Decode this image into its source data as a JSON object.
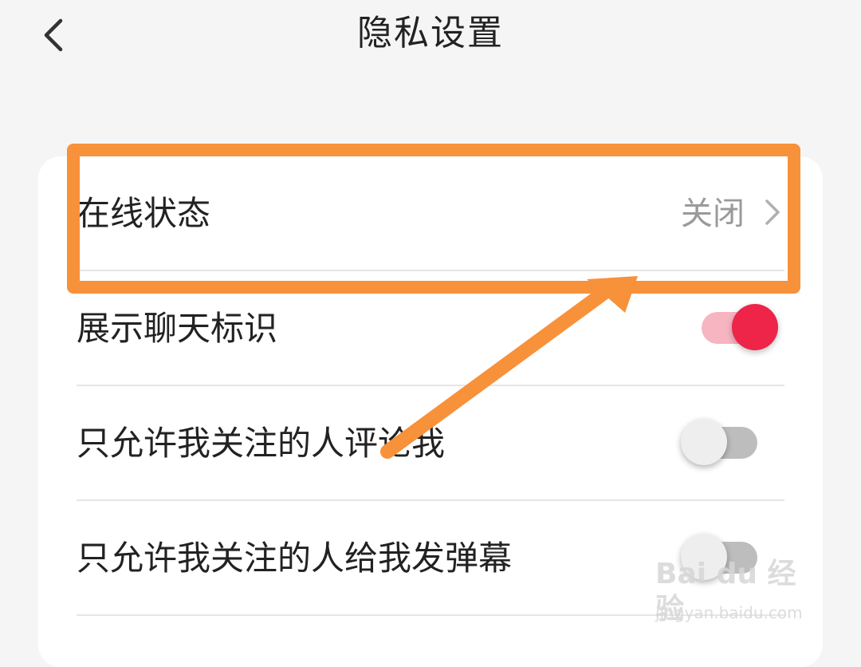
{
  "header": {
    "title": "隐私设置",
    "back_icon": "chevron-left-icon"
  },
  "settings": {
    "online_status": {
      "label": "在线状态",
      "value": "关闭",
      "icon": "chevron-right-icon"
    },
    "show_chat_badge": {
      "label": "展示聊天标识",
      "enabled": true
    },
    "comment_followed_only": {
      "label": "只允许我关注的人评论我",
      "enabled": false
    },
    "danmaku_followed_only": {
      "label": "只允许我关注的人给我发弹幕",
      "enabled": false
    }
  },
  "colors": {
    "annotation": "#f7913a",
    "toggle_on": "#ee2449",
    "toggle_on_track": "#f6b5c1",
    "toggle_off_track": "#bdbdbd"
  },
  "watermark": {
    "brand": "Bai du 经验",
    "url": "jingyan.baidu.com"
  }
}
